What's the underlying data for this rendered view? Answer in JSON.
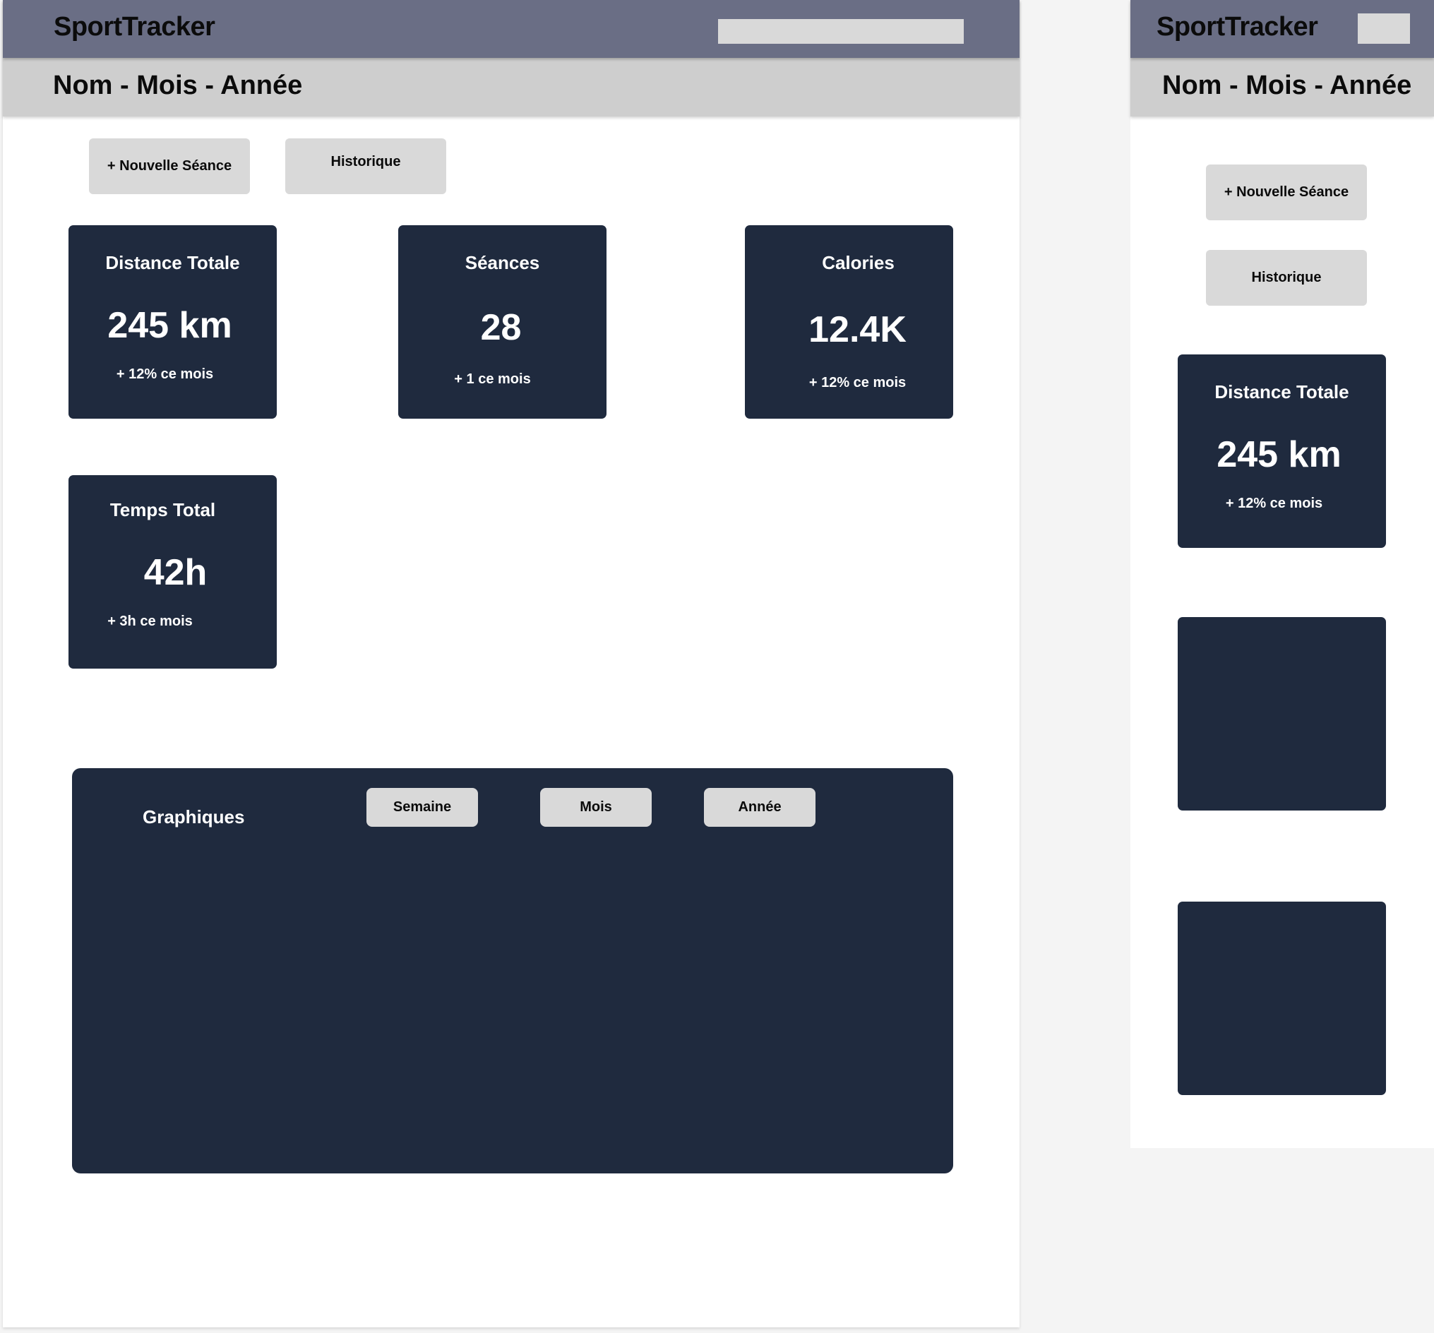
{
  "desktop": {
    "header": {
      "brand": "SportTracker"
    },
    "subheader": {
      "title": "Nom - Mois - Année"
    },
    "actions": {
      "new_session": "+ Nouvelle Séance",
      "history": "Historique"
    },
    "stats": [
      {
        "label": "Distance Totale",
        "value": "245 km",
        "change": "+ 12% ce mois"
      },
      {
        "label": "Séances",
        "value": "28",
        "change": "+ 1 ce mois"
      },
      {
        "label": "Calories",
        "value": "12.4K",
        "change": "+ 12% ce mois"
      },
      {
        "label": "Temps Total",
        "value": "42h",
        "change": "+ 3h ce mois"
      }
    ],
    "charts": {
      "title": "Graphiques",
      "tabs": [
        "Semaine",
        "Mois",
        "Année"
      ]
    }
  },
  "mobile": {
    "header": {
      "brand": "SportTracker"
    },
    "subheader": {
      "title": "Nom - Mois - Année"
    },
    "actions": {
      "new_session": "+ Nouvelle Séance",
      "history": "Historique"
    },
    "stats": [
      {
        "label": "Distance Totale",
        "value": "245 km",
        "change": "+ 12% ce mois"
      }
    ]
  },
  "colors": {
    "header_bg": "#6a6e85",
    "subheader_bg": "#cecece",
    "card_bg": "#1f2a3e",
    "button_bg": "#d9d9d9"
  }
}
